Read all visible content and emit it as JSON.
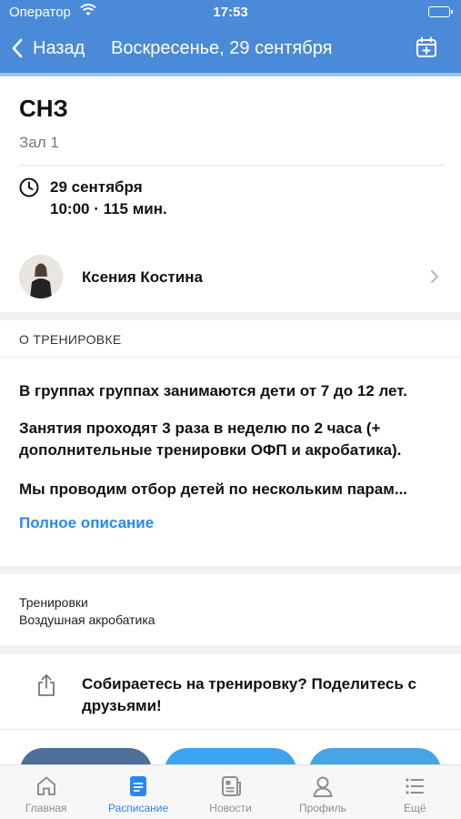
{
  "status_bar": {
    "carrier": "Оператор",
    "time": "17:53"
  },
  "nav": {
    "back_label": "Назад",
    "title": "Воскресенье, 29 сентября"
  },
  "event": {
    "title": "СНЗ",
    "hall": "Зал 1",
    "date": "29 сентября",
    "time_duration": "10:00 · 115 мин."
  },
  "trainer": {
    "name": "Ксения Костина"
  },
  "about": {
    "header": "О ТРЕНИРОВКЕ",
    "paragraphs": [
      "В группах группах занимаются дети от 7 до 12 лет.",
      "Занятия проходят 3 раза в неделю по 2 часа (+ дополнительные тренировки ОФП и акробатика).",
      "Мы проводим отбор детей по нескольким парам..."
    ],
    "full_link": "Полное описание"
  },
  "category": {
    "label": "Тренировки",
    "value": "Воздушная акробатика"
  },
  "share": {
    "text": "Собираетесь на тренировку? Поделитесь с друзьями!"
  },
  "colors": {
    "header": "#4a8ad8",
    "accent": "#2787f5",
    "vk": "#4d6f98",
    "twitter": "#3ea4f2",
    "telegram": "#47a6e1"
  },
  "tabbar": {
    "tabs": [
      {
        "label": "Главная",
        "icon": "home-icon"
      },
      {
        "label": "Расписание",
        "icon": "schedule-icon",
        "active": true
      },
      {
        "label": "Новости",
        "icon": "news-icon"
      },
      {
        "label": "Профиль",
        "icon": "profile-icon"
      },
      {
        "label": "Ещё",
        "icon": "more-icon"
      }
    ]
  }
}
